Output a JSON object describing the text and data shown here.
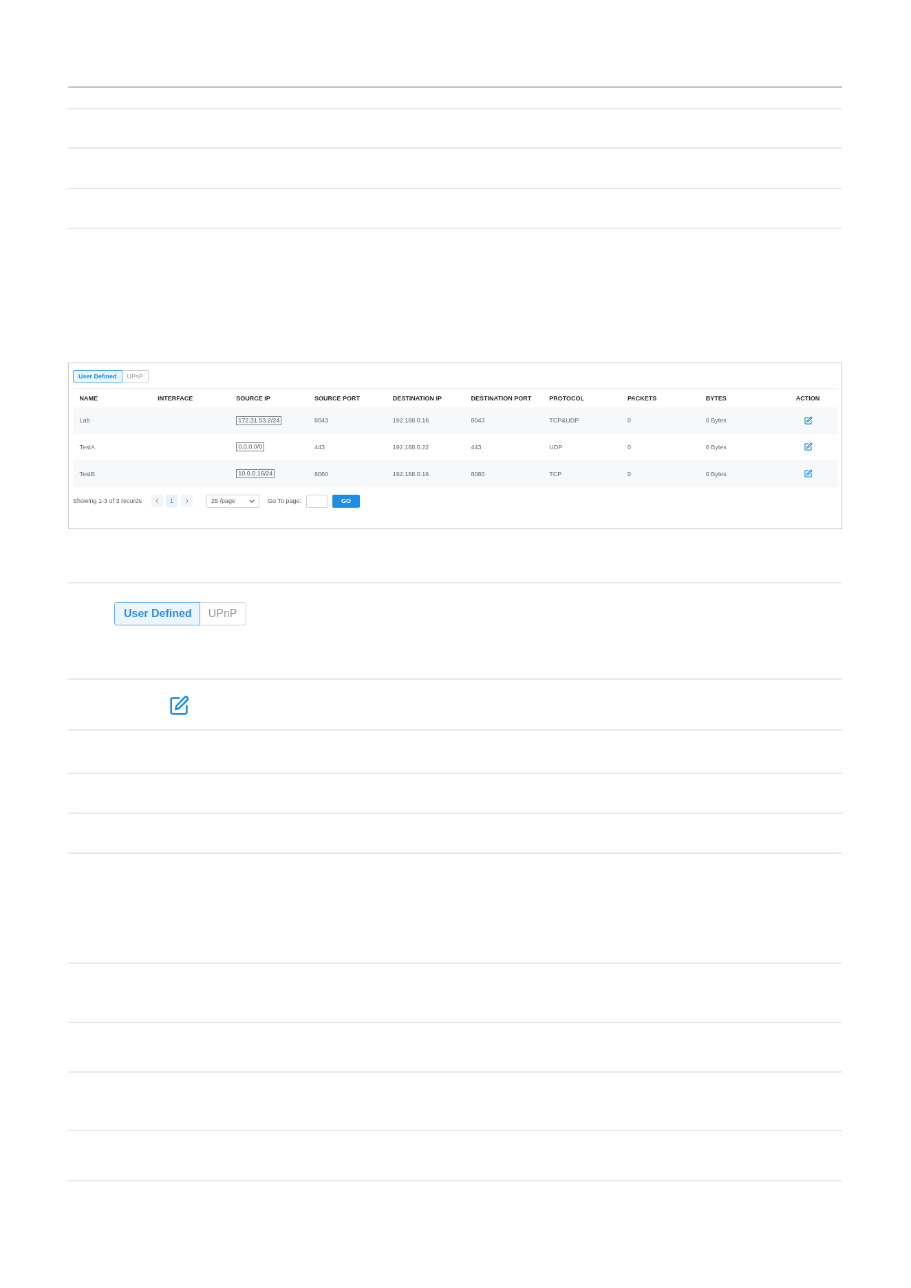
{
  "figure": {
    "tabs": [
      {
        "label": "User Defined",
        "selected": true
      },
      {
        "label": "UPnP",
        "selected": false
      }
    ],
    "table": {
      "columns": [
        "NAME",
        "INTERFACE",
        "SOURCE IP",
        "SOURCE PORT",
        "DESTINATION IP",
        "DESTINATION PORT",
        "PROTOCOL",
        "PACKETS",
        "BYTES",
        "ACTION"
      ],
      "rows": [
        {
          "name": "Lab",
          "source_ip": "172.31.53.2/24",
          "source_port": "8043",
          "destination_ip": "192.168.0.16",
          "destination_port": "8043",
          "protocol": "TCP&UDP",
          "packets": "0",
          "bytes": "0 Bytes"
        },
        {
          "name": "TestA",
          "source_ip": "0.0.0.0/0",
          "source_port": "443",
          "destination_ip": "192.168.0.22",
          "destination_port": "443",
          "protocol": "UDP",
          "packets": "0",
          "bytes": "0 Bytes"
        },
        {
          "name": "TestB",
          "source_ip": "10.0.0.16/24",
          "source_port": "8080",
          "destination_ip": "192.168.0.16",
          "destination_port": "8080",
          "protocol": "TCP",
          "packets": "0",
          "bytes": "0 Bytes"
        }
      ]
    },
    "pagination": {
      "summary": "Showing 1-3 of 3 records",
      "pages": [
        {
          "label": "1",
          "selected": true
        }
      ],
      "page_size": "25 /page",
      "goto_label": "Go To page:",
      "go_button": "GO"
    }
  },
  "legend": {
    "tabs": [
      {
        "label": "User Defined",
        "selected": true
      },
      {
        "label": "UPnP",
        "selected": false
      }
    ]
  }
}
